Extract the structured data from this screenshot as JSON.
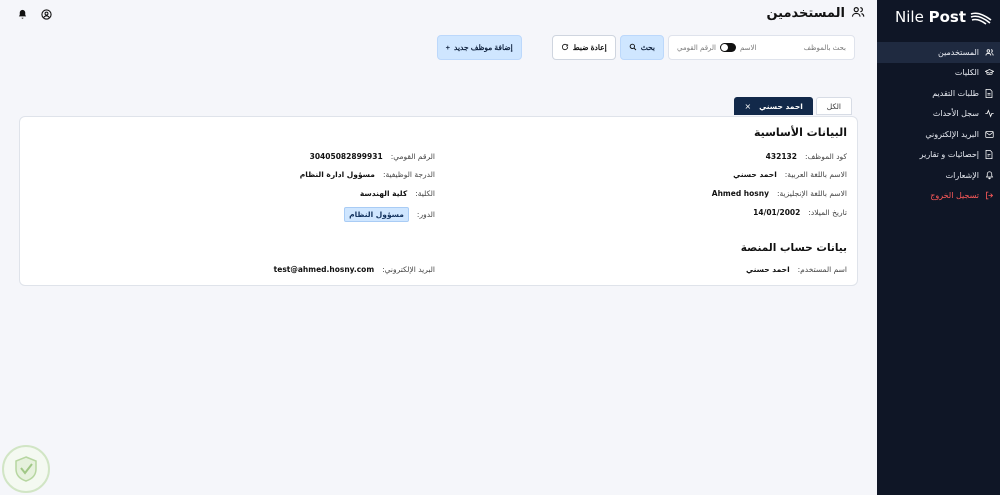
{
  "brand": {
    "name_light": "Nile",
    "name_bold": "Post"
  },
  "sidebar": {
    "items": [
      {
        "label": "المستخدمين",
        "icon": "users-icon",
        "active": true
      },
      {
        "label": "الكليات",
        "icon": "graduation-cap-icon"
      },
      {
        "label": "طلبات التقديم",
        "icon": "document-icon"
      },
      {
        "label": "سجل الأحداث",
        "icon": "activity-icon"
      },
      {
        "label": "البريد الإلكتروني",
        "icon": "mail-icon"
      },
      {
        "label": "إحصائيات و تقارير",
        "icon": "report-icon"
      },
      {
        "label": "الإشعارات",
        "icon": "bell-icon"
      },
      {
        "label": "تسجيل الخروج",
        "icon": "logout-icon",
        "danger": true
      }
    ]
  },
  "header": {
    "title": "المستخدمين"
  },
  "toolbar": {
    "search_placeholder": "بحث بالموظف",
    "toggle_left": "الرقم القومي",
    "toggle_right": "الاسم",
    "search_label": "بحث",
    "reset_label": "إعادة ضبط",
    "add_label": "إضافة موظف جديد"
  },
  "tabs": [
    {
      "label": "الكل"
    },
    {
      "label": "احمد حسني",
      "closable": true
    }
  ],
  "card": {
    "basic_title": "البيانات الأساسية",
    "platform_title": "بيانات حساب المنصة",
    "fields": {
      "employee_code": {
        "label": "كود الموظف:",
        "value": "432132"
      },
      "national_id": {
        "label": "الرقم القومي:",
        "value": "30405082899931"
      },
      "name_ar": {
        "label": "الاسم باللغة العربية:",
        "value": "احمد حسني"
      },
      "job_grade": {
        "label": "الدرجة الوظيفية:",
        "value": "مسؤول ادارة النظام"
      },
      "name_en": {
        "label": "الاسم باللغة الإنجليزية:",
        "value": "Ahmed hosny"
      },
      "faculty": {
        "label": "الكلية:",
        "value": "كلية الهندسة"
      },
      "birth_date": {
        "label": "تاريخ الميلاد:",
        "value": "14/01/2002"
      },
      "role": {
        "label": "الدور:",
        "value": "مسؤول النظام"
      },
      "username": {
        "label": "اسم المستخدم:",
        "value": "احمد حسني"
      },
      "email": {
        "label": "البريد الإلكتروني:",
        "value": "test@ahmed.hosny.com"
      }
    }
  },
  "colors": {
    "sidebar_bg": "#0f1626",
    "accent": "#cfe6ff",
    "tab_active": "#12294a",
    "danger": "#ff5a5a"
  }
}
